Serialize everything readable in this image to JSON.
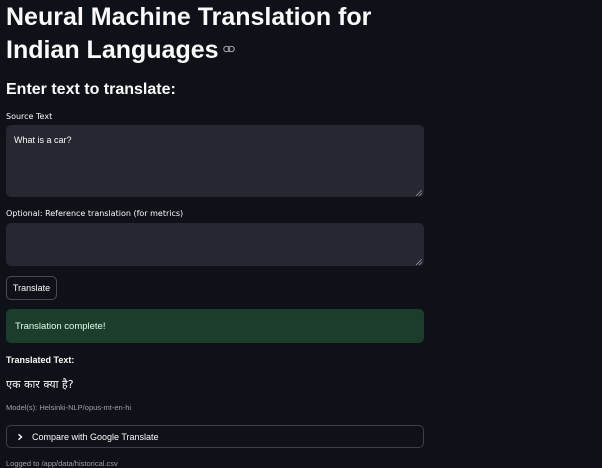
{
  "header": {
    "title": "Neural Machine Translation for Indian Languages",
    "anchor_icon": "link-icon"
  },
  "form": {
    "subheader": "Enter text to translate:",
    "source_label": "Source Text",
    "source_value": "What is a car?",
    "reference_label": "Optional: Reference translation (for metrics)",
    "reference_value": "",
    "translate_button": "Translate"
  },
  "result": {
    "alert_text": "Translation complete!",
    "alert_color": "#1c3d2b",
    "translated_label": "Translated Text:",
    "translated_value": "एक कार क्या है?",
    "models_caption": "Model(s): Helsinki-NLP/opus-mt-en-hi",
    "expander_label": "Compare with Google Translate",
    "expander_icon": "chevron-right-icon",
    "log_caption": "Logged to /app/data/historical.csv"
  }
}
